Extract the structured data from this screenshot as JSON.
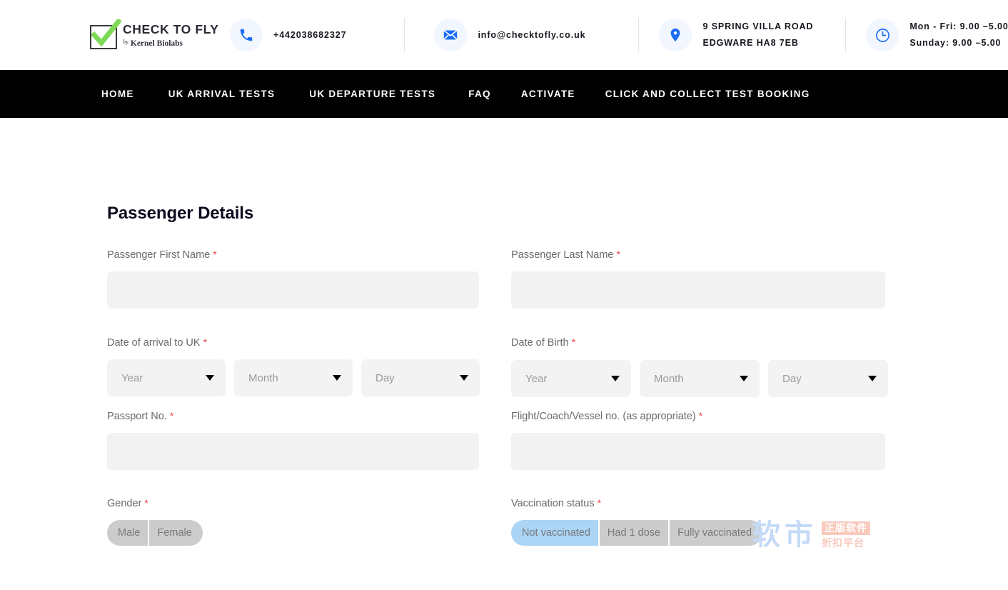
{
  "brand": {
    "logo_title": "CHECK TO FLY",
    "logo_sub_prefix": "by",
    "logo_sub": "Kernel Biolabs"
  },
  "topbar": {
    "phone_icon": "phone-icon",
    "phone": "+442038682327",
    "email_icon": "envelope-icon",
    "email": "info@checktofly.co.uk",
    "location_icon": "map-pin-icon",
    "address_line1": "9 SPRING VILLA ROAD",
    "address_line2": "EDGWARE HA8 7EB",
    "hours_icon": "clock-icon",
    "hours_line1": "Mon - Fri: 9.00 –5.00",
    "hours_line2": "Sunday: 9.00 –5.00"
  },
  "nav": {
    "items": [
      {
        "label": "HOME"
      },
      {
        "label": "UK ARRIVAL TESTS"
      },
      {
        "label": "UK DEPARTURE TESTS"
      },
      {
        "label": "FAQ"
      },
      {
        "label": "ACTIVATE"
      },
      {
        "label": "CLICK AND COLLECT TEST BOOKING"
      }
    ]
  },
  "form": {
    "title": "Passenger Details",
    "required_mark": "*",
    "first_name": {
      "label": "Passenger First Name",
      "value": "",
      "placeholder": ""
    },
    "last_name": {
      "label": "Passenger Last Name",
      "value": "",
      "placeholder": ""
    },
    "arrival_date": {
      "label": "Date of arrival to UK",
      "year": "Year",
      "month": "Month",
      "day": "Day"
    },
    "birth_date": {
      "label": "Date of Birth",
      "year": "Year",
      "month": "Month",
      "day": "Day"
    },
    "passport": {
      "label": "Passport No.",
      "value": "",
      "placeholder": ""
    },
    "flight": {
      "label": "Flight/Coach/Vessel no. (as appropriate)",
      "value": "",
      "placeholder": ""
    },
    "gender": {
      "label": "Gender",
      "options": [
        {
          "label": "Male",
          "selected": false
        },
        {
          "label": "Female",
          "selected": false
        }
      ]
    },
    "vaccination": {
      "label": "Vaccination status",
      "options": [
        {
          "label": "Not vaccinated",
          "selected": true
        },
        {
          "label": "Had 1 dose",
          "selected": false
        },
        {
          "label": "Fully vaccinated",
          "selected": false
        }
      ]
    }
  },
  "watermark": {
    "cn": "软市",
    "box": "正版软件",
    "sub": "折扣平台"
  },
  "colors": {
    "accent_blue": "#1a6cf5",
    "icon_bg": "#f2f6fe",
    "nav_bg": "#000000",
    "input_bg": "#f2f2f2",
    "required_red": "#f0404a",
    "segment_bg": "#cccccc",
    "segment_selected": "#abd4f5"
  }
}
